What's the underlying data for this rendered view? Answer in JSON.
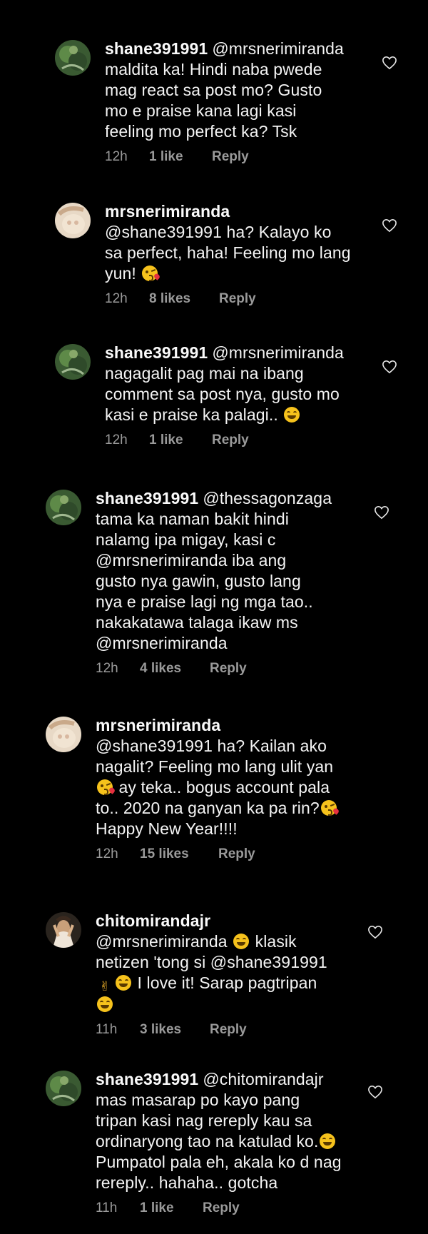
{
  "comments": [
    {
      "username": "shane391991",
      "lines": [
        "@mrsnerimiranda",
        "maldita ka! Hindi naba pwede",
        "mag react sa post mo? Gusto",
        "mo e praise kana lagi kasi",
        "feeling mo perfect ka? Tsk"
      ],
      "time": "12h",
      "likes": "1 like",
      "reply": "Reply",
      "avatar": "shane-avatar"
    },
    {
      "username": "mrsnerimiranda",
      "lines": [
        "",
        "@shane391991 ha? Kalayo ko",
        "sa perfect, haha! Feeling mo lang",
        "yun!"
      ],
      "time": "12h",
      "likes": "8 likes",
      "reply": "Reply",
      "avatar": "neri-avatar"
    },
    {
      "username": "shane391991",
      "lines": [
        "@mrsnerimiranda",
        "nagagalit pag mai na ibang",
        "comment sa post nya, gusto mo",
        "kasi e praise ka palagi.."
      ],
      "time": "12h",
      "likes": "1 like",
      "reply": "Reply",
      "avatar": "shane-avatar"
    },
    {
      "username": "shane391991",
      "lines": [
        "@thessagonzaga",
        "tama ka naman bakit hindi",
        "nalamg ipa migay, kasi c",
        "@mrsnerimiranda  iba ang",
        "gusto nya gawin, gusto lang",
        "nya e praise lagi ng mga tao..",
        "nakakatawa talaga ikaw ms",
        "@mrsnerimiranda"
      ],
      "time": "12h",
      "likes": "4 likes",
      "reply": "Reply",
      "avatar": "shane-avatar"
    },
    {
      "username": "mrsnerimiranda",
      "lines": [
        "",
        "@shane391991 ha? Kailan ako",
        "nagalit? Feeling mo lang ulit yan",
        "ay teka.. bogus account pala",
        "to.. 2020 na ganyan ka pa rin?",
        "Happy New Year!!!!"
      ],
      "time": "12h",
      "likes": "15 likes",
      "reply": "Reply",
      "avatar": "neri-avatar"
    },
    {
      "username": "chitomirandajr",
      "lines": [
        "",
        "@mrsnerimiranda",
        "klasik",
        "netizen 'tong si @shane391991",
        "I love it! Sarap pagtripan",
        ""
      ],
      "time": "11h",
      "likes": "3 likes",
      "reply": "Reply",
      "avatar": "chito-avatar"
    },
    {
      "username": "shane391991",
      "lines": [
        "@chitomirandajr",
        "mas masarap po kayo pang",
        "tripan kasi nag rereply kau sa",
        "ordinaryong tao na katulad ko.",
        "Pumpatol pala eh, akala ko d nag",
        "rereply.. hahaha.. gotcha"
      ],
      "time": "11h",
      "likes": "1 like",
      "reply": "Reply",
      "avatar": "shane-avatar"
    }
  ],
  "colors": {
    "background": "#000000",
    "text": "#f4f4f4",
    "meta": "#9a9a9a",
    "emoji": "#f6c21c"
  },
  "icons": {
    "like": "heart-outline-icon",
    "smile": "grinning-emoji",
    "kiss": "face-blowing-kiss-emoji",
    "rock": "sign-of-horns-emoji"
  }
}
